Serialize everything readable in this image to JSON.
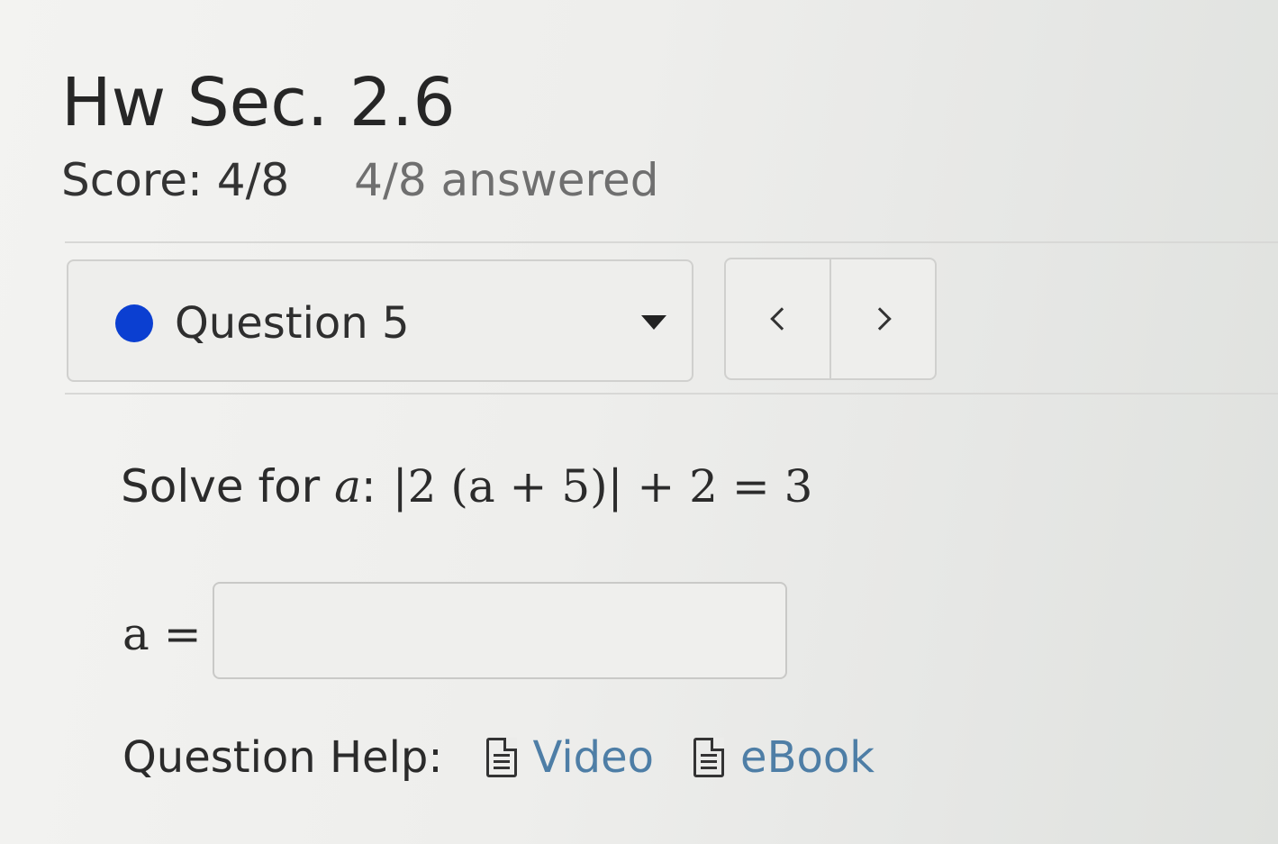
{
  "assignment": {
    "title": "Hw Sec. 2.6",
    "score": "Score: 4/8",
    "answered": "4/8 answered"
  },
  "question_nav": {
    "current_label": "Question 5",
    "status_color": "#0b3fd1",
    "prev_icon": "chevron-left-icon",
    "next_icon": "chevron-right-icon"
  },
  "question": {
    "prompt_prefix": "Solve for ",
    "variable": "a",
    "colon": ":",
    "expression": "|2 (a + 5)| + 2 = 3"
  },
  "answer": {
    "label": "a =",
    "value": "",
    "placeholder": ""
  },
  "help": {
    "label": "Question Help:",
    "links": [
      {
        "label": "Video",
        "icon": "document-icon"
      },
      {
        "label": "eBook",
        "icon": "document-icon"
      }
    ]
  },
  "colors": {
    "link": "#4e7ea6",
    "status_dot": "#0b3fd1"
  }
}
